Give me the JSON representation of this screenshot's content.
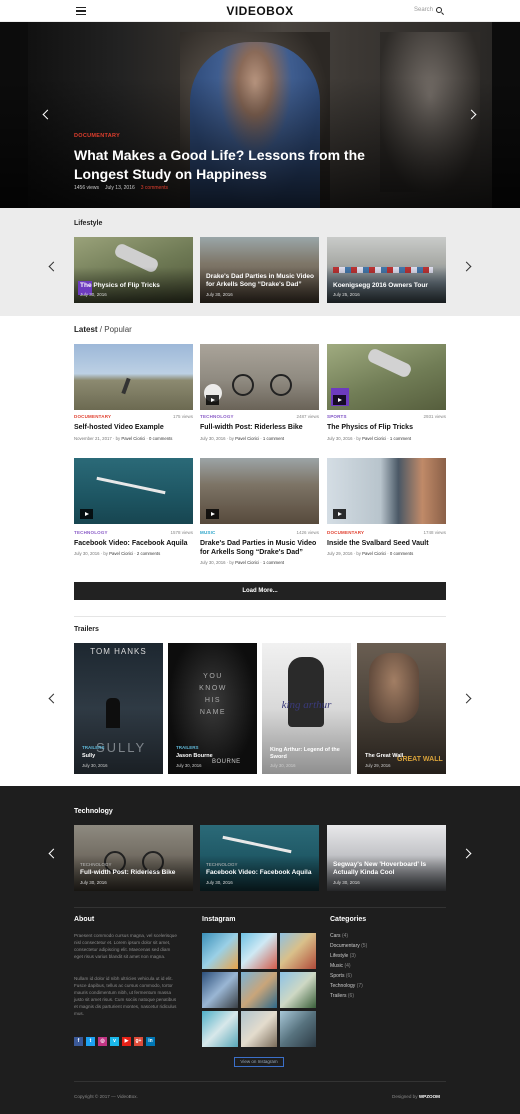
{
  "header": {
    "logo": "VIDEOBOX",
    "search_label": "Search"
  },
  "hero": {
    "category": "DOCUMENTARY",
    "title": "What Makes a Good Life? Lessons from the Longest Study on Happiness",
    "views": "1456 views",
    "date": "July 13, 2016",
    "comments": "3 comments"
  },
  "lifestyle": {
    "title": "Lifestyle",
    "items": [
      {
        "title": "The Physics of Flip Tricks",
        "date": "July 30, 2016"
      },
      {
        "title": "Drake's Dad Parties in Music Video for Arkells Song “Drake's Dad”",
        "date": "July 30, 2016"
      },
      {
        "title": "Koenigsegg 2016 Owners Tour",
        "date": "July 25, 2016"
      }
    ]
  },
  "latest": {
    "title": "Latest",
    "alt_tab": "Popular",
    "items": [
      {
        "category": "DOCUMENTARY",
        "views": "175 views",
        "title": "Self-hosted Video Example",
        "date": "November 21, 2017",
        "author": "Pavel Ciorici",
        "comments": "0 comments"
      },
      {
        "category": "TECHNOLOGY",
        "views": "2487 views",
        "title": "Full-width Post: Riderless Bike",
        "date": "July 30, 2016",
        "author": "Pavel Ciorici",
        "comments": "1 comment"
      },
      {
        "category": "SPORTS",
        "views": "2931 views",
        "title": "The Physics of Flip Tricks",
        "date": "July 30, 2016",
        "author": "Pavel Ciorici",
        "comments": "1 comment"
      },
      {
        "category": "TECHNOLOGY",
        "views": "1578 views",
        "title": "Facebook Video: Facebook Aquila",
        "date": "July 30, 2016",
        "author": "Pavel Ciorici",
        "comments": "2 comments"
      },
      {
        "category": "MUSIC",
        "views": "1426 views",
        "title": "Drake's Dad Parties in Music Video for Arkells Song “Drake's Dad”",
        "date": "July 30, 2016",
        "author": "Pavel Ciorici",
        "comments": "1 comment"
      },
      {
        "category": "DOCUMENTARY",
        "views": "1748 views",
        "title": "Inside the Svalbard Seed Vault",
        "date": "July 29, 2016",
        "author": "Pavel Ciorici",
        "comments": "0 comments"
      }
    ],
    "by_label": "by",
    "load_more": "Load More..."
  },
  "trailers": {
    "title": "Trailers",
    "items": [
      {
        "category": "TRAILERS",
        "title": "Sully",
        "date": "July 30, 2016",
        "poster_text": "TOM HANKS",
        "poster_sub": "SULLY"
      },
      {
        "category": "TRAILERS",
        "title": "Jason Bourne",
        "date": "July 30, 2016",
        "poster_text": "YOU KNOW HIS NAME",
        "poster_sub": "BOURNE"
      },
      {
        "category": "",
        "title": "King Arthur: Legend of the Sword",
        "date": "July 30, 2016",
        "poster_text": "king arthur"
      },
      {
        "category": "",
        "title": "The Great Wall",
        "date": "July 29, 2016",
        "poster_text": "GREAT WALL"
      }
    ]
  },
  "technology": {
    "title": "Technology",
    "items": [
      {
        "category": "TECHNOLOGY",
        "title": "Full-width Post: Riderless Bike",
        "date": "July 30, 2016"
      },
      {
        "category": "TECHNOLOGY",
        "title": "Facebook Video: Facebook Aquila",
        "date": "July 30, 2016"
      },
      {
        "category": "",
        "title": "Segway's New 'Hoverboard' Is Actually Kinda Cool",
        "date": "July 30, 2016"
      }
    ]
  },
  "footer": {
    "about_title": "About",
    "about_p1": "Praesent commodo cursus magna, vel scelerisque nisl consectetur et. Lorem ipsum dolor sit amet, consectetur adipiscing elit. Maecenas sed diam eget risus varius blandit sit amet non magna.",
    "about_p2": "Nullam id dolor id nibh ultricies vehicula ut id elit. Fusce dapibus, tellus ac cursus commodo, tortor mauris condimentum nibh, ut fermentum massa justo sit amet risus. Cum sociis natoque penatibus et magnis dis parturient montes, nascetur ridiculus mus.",
    "instagram_title": "Instagram",
    "view_instagram": "View on Instagram",
    "categories_title": "Categories",
    "categories": [
      {
        "name": "Cars",
        "count": "(4)"
      },
      {
        "name": "Documentary",
        "count": "(5)"
      },
      {
        "name": "Lifestyle",
        "count": "(3)"
      },
      {
        "name": "Music",
        "count": "(4)"
      },
      {
        "name": "Sports",
        "count": "(6)"
      },
      {
        "name": "Technology",
        "count": "(7)"
      },
      {
        "name": "Trailers",
        "count": "(6)"
      }
    ],
    "copyright": "Copyright © 2017 — VideoBox.",
    "designed_by": "Designed by",
    "designer": "WPZOOM"
  },
  "social": [
    {
      "icon": "facebook-icon",
      "glyph": "f",
      "color": "#3b5998"
    },
    {
      "icon": "twitter-icon",
      "glyph": "t",
      "color": "#1da1f2"
    },
    {
      "icon": "instagram-icon",
      "glyph": "◎",
      "color": "#c13584"
    },
    {
      "icon": "vimeo-icon",
      "glyph": "v",
      "color": "#1ab7ea"
    },
    {
      "icon": "youtube-icon",
      "glyph": "▶",
      "color": "#e62117"
    },
    {
      "icon": "googleplus-icon",
      "glyph": "g+",
      "color": "#dd4b39"
    },
    {
      "icon": "linkedin-icon",
      "glyph": "in",
      "color": "#0077b5"
    }
  ],
  "colors": {
    "accent": "#e03e2d",
    "technology": "#8a5cc7",
    "sports": "#7c4fc4",
    "music": "#2aa4c9",
    "dark_bg": "#1e1e1e"
  }
}
